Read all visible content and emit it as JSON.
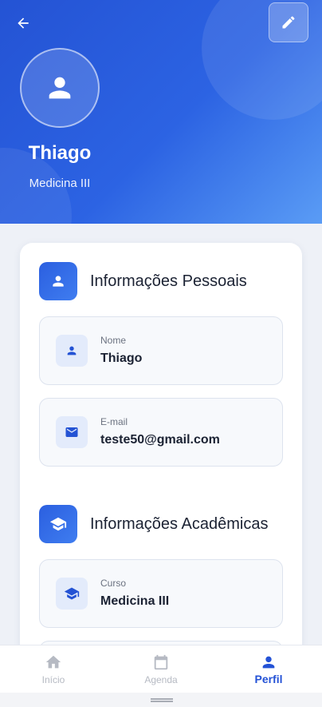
{
  "profile": {
    "name": "Thiago",
    "course": "Medicina III"
  },
  "sections": {
    "personal": {
      "title": "Informações Pessoais",
      "fields": [
        {
          "label": "Nome",
          "value": "Thiago",
          "icon": "person-icon"
        },
        {
          "label": "E-mail",
          "value": "teste50@gmail.com",
          "icon": "email-icon"
        }
      ]
    },
    "academic": {
      "title": "Informações Acadêmicas",
      "fields": [
        {
          "label": "Curso",
          "value": "Medicina III",
          "icon": "graduation-cap-icon"
        }
      ]
    }
  },
  "nav": {
    "items": [
      {
        "label": "Início",
        "icon": "home-icon",
        "active": false
      },
      {
        "label": "Agenda",
        "icon": "calendar-icon",
        "active": false
      },
      {
        "label": "Perfil",
        "icon": "person-icon",
        "active": true
      }
    ]
  },
  "colors": {
    "primary": "#2453d4",
    "header_gradient_end": "#5a9cf5",
    "nav_inactive": "#b6bac3",
    "background": "#eef1f7"
  }
}
